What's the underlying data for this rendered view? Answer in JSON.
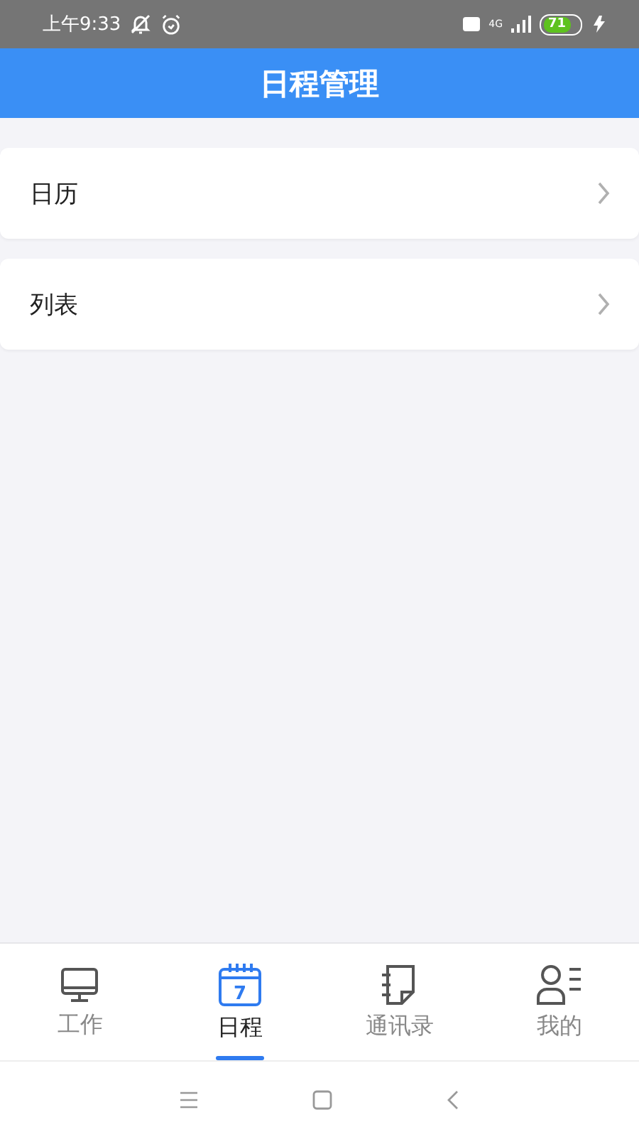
{
  "status_bar": {
    "time": "上午9:33",
    "network": "4G",
    "battery": "71"
  },
  "header": {
    "title": "日程管理"
  },
  "menu": [
    {
      "label": "日历"
    },
    {
      "label": "列表"
    }
  ],
  "tabs": [
    {
      "label": "工作",
      "kind": "monitor",
      "selected": false
    },
    {
      "label": "日程",
      "kind": "calendar",
      "icon_text": "7",
      "selected": true
    },
    {
      "label": "通讯录",
      "kind": "notebook",
      "selected": false
    },
    {
      "label": "我的",
      "kind": "person",
      "selected": false
    }
  ]
}
